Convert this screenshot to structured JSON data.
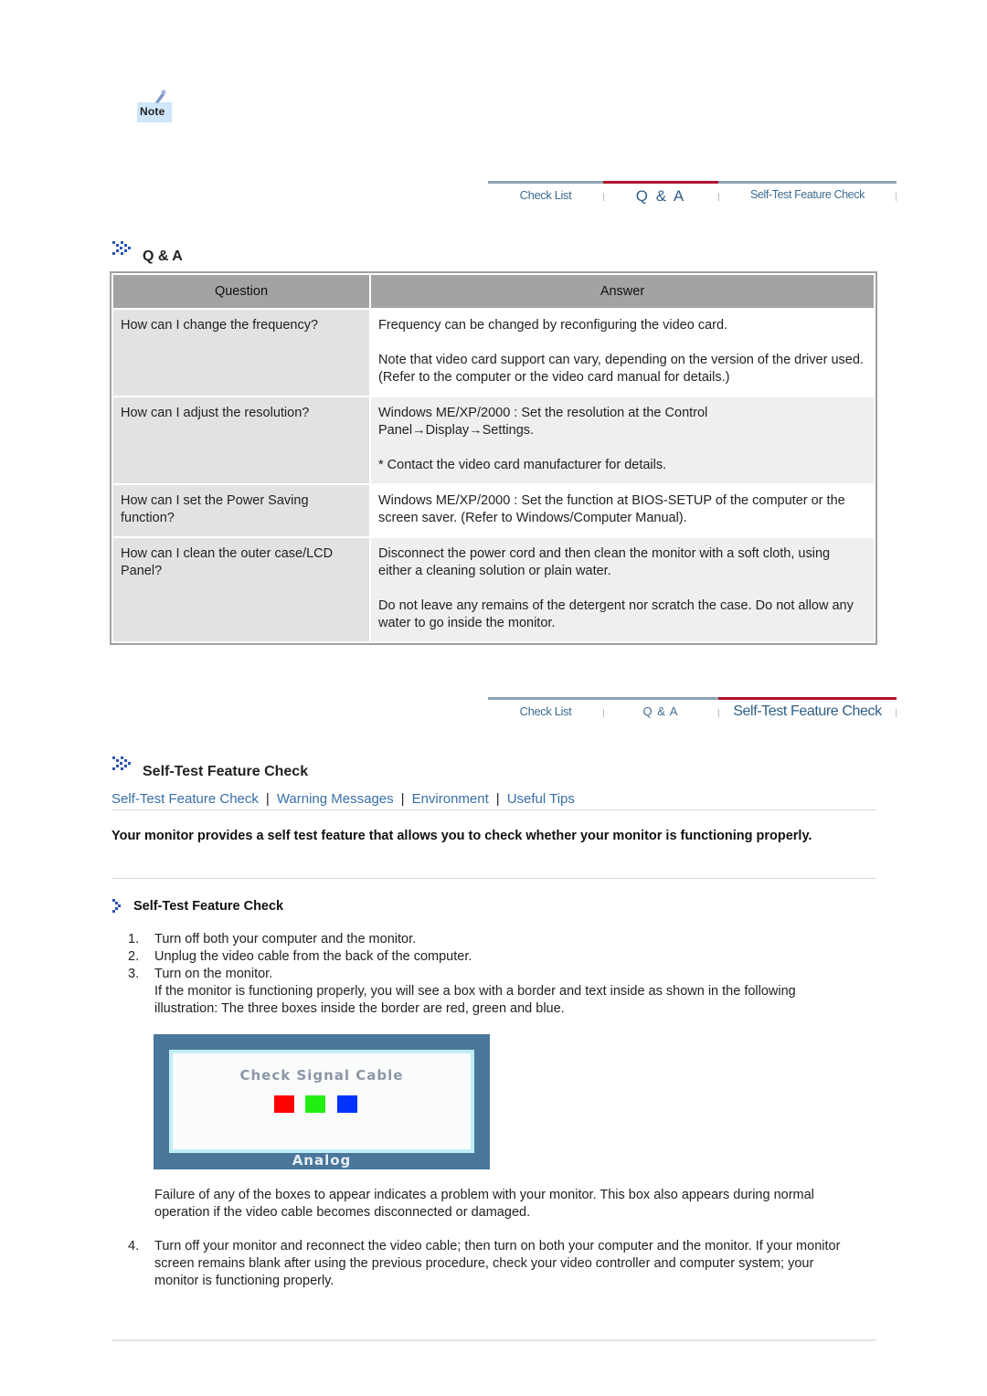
{
  "note_icon": {
    "label": "Note",
    "icon": "note-pen-icon"
  },
  "tabs_top": {
    "items": [
      {
        "label": "Check List",
        "active": false
      },
      {
        "label": "Q & A",
        "active": true
      },
      {
        "label": "Self-Test Feature Check",
        "active": false
      }
    ]
  },
  "qa_section": {
    "title": "Q & A",
    "icon": "double-chevron-icon",
    "table": {
      "headers": [
        "Question",
        "Answer"
      ],
      "rows": [
        {
          "question": "How can I change the frequency?",
          "answer": [
            "Frequency can be changed by reconfiguring the video card.",
            "Note that video card support can vary, depending on the version of the driver used. (Refer to the computer or the video card manual for details.)"
          ]
        },
        {
          "question": "How can I adjust the resolution?",
          "answer": [
            "Windows ME/XP/2000 : Set the resolution at the Control Panel→Display→Settings.",
            "* Contact the video card manufacturer for details."
          ]
        },
        {
          "question": "How can I set the Power Saving function?",
          "answer": [
            "Windows ME/XP/2000 : Set the function at BIOS-SETUP of the computer or the screen saver. (Refer to Windows/Computer Manual)."
          ]
        },
        {
          "question": "How can I clean the outer case/LCD Panel?",
          "answer": [
            "Disconnect the power cord and then clean the monitor with a soft cloth, using either a cleaning solution or plain water.",
            "Do not leave any remains of the detergent nor scratch the case. Do not allow any water to go inside the monitor."
          ]
        }
      ]
    }
  },
  "tabs_bottom": {
    "items": [
      {
        "label": "Check List",
        "active": false
      },
      {
        "label": "Q & A",
        "active": false
      },
      {
        "label": "Self-Test Feature Check",
        "active": true
      }
    ]
  },
  "selftest_section": {
    "title": "Self-Test Feature Check",
    "icon": "double-chevron-icon",
    "links": [
      "Self-Test Feature Check",
      "Warning Messages",
      "Environment",
      "Useful Tips"
    ],
    "link_separator": "|",
    "link_color": "#3a6fa8",
    "intro": "Your monitor provides a self test feature that allows you to check whether your monitor is functioning properly.",
    "subheading": "Self-Test Feature Check",
    "steps": [
      {
        "num": "1.",
        "text": "Turn off both your computer and the monitor."
      },
      {
        "num": "2.",
        "text": "Unplug the video cable from the back of the computer."
      },
      {
        "num": "3.",
        "text": "Turn on the monitor."
      }
    ],
    "step3_detail": "If the monitor is functioning properly, you will see a box with a border and text inside as shown in the following illustration: The three boxes inside the border are red, green and blue.",
    "illustration": {
      "message": "Check Signal Cable",
      "footer": "Analog",
      "squares": [
        {
          "name": "red",
          "color": "#ff0000"
        },
        {
          "name": "green",
          "color": "#22ee11"
        },
        {
          "name": "blue",
          "color": "#0033ff"
        }
      ]
    },
    "after_illustration": "Failure of any of the boxes to appear indicates a problem with your monitor. This box also appears during normal operation if the video cable becomes disconnected or damaged.",
    "step4": {
      "num": "4.",
      "text": "Turn off your monitor and reconnect the video cable; then turn on both your computer and the monitor. If your monitor screen remains blank after using the previous procedure, check your video controller and computer system; your monitor is functioning properly."
    }
  }
}
